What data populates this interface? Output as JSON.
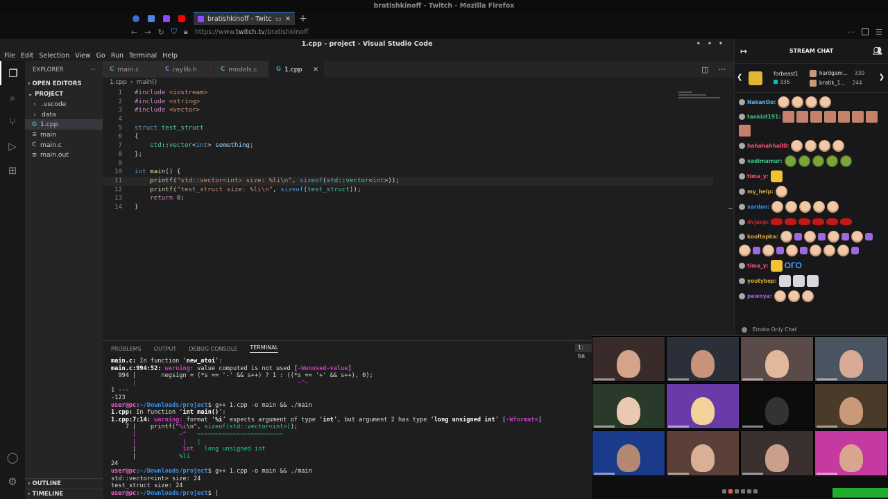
{
  "browser": {
    "window_title": "bratishkinoff - Twitch - Mozilla Firefox",
    "tab_title": "bratishkinoff - Twitch",
    "url_prefix": "https://www.",
    "url_host": "twitch.tv",
    "url_path": "/bratishkinoff",
    "new_tab_glyph": "+",
    "tab_close_glyph": "✕"
  },
  "vscode": {
    "window_title": "1.cpp - project - Visual Studio Code",
    "menu": [
      "File",
      "Edit",
      "Selection",
      "View",
      "Go",
      "Run",
      "Terminal",
      "Help"
    ],
    "explorer": {
      "header": "EXPLORER",
      "open_editors": "OPEN EDITORS",
      "project": "PROJECT",
      "items": [
        {
          "label": ".vscode",
          "kind": "folder"
        },
        {
          "label": "data",
          "kind": "folder"
        },
        {
          "label": "1.cpp",
          "kind": "cpp",
          "selected": true
        },
        {
          "label": "main",
          "kind": "file"
        },
        {
          "label": "main.c",
          "kind": "c"
        },
        {
          "label": "main.out",
          "kind": "file"
        }
      ],
      "outline": "OUTLINE",
      "timeline": "TIMELINE"
    },
    "tabs": [
      {
        "label": "main.c",
        "icon": "C",
        "active": false
      },
      {
        "label": "raylib.h",
        "icon": "C",
        "active": false
      },
      {
        "label": "models.c",
        "icon": "C",
        "active": false
      },
      {
        "label": "1.cpp",
        "icon": "G",
        "active": true
      }
    ],
    "breadcrumb": [
      "1.cpp",
      "main()"
    ],
    "code_lines": [
      "1",
      "2",
      "3",
      "4",
      "5",
      "6",
      "7",
      "8",
      "9",
      "10",
      "11",
      "12",
      "13",
      "14"
    ],
    "panel_tabs": [
      "PROBLEMS",
      "OUTPUT",
      "DEBUG CONSOLE",
      "TERMINAL"
    ],
    "side_label": "1: ba"
  },
  "terminal": {
    "l1_file": "main.c:",
    "l1_text": " In function ‘",
    "l1_fn": "new_atoi",
    "l1_end": "’:",
    "l2_loc": "main.c:994:52:",
    "l2_warn": "warning:",
    "l2_msg": " value computed is not used [",
    "l2_flag": "-Wunused-value",
    "l2_end": "]",
    "l3": "  994 |       negsign = (*s == '-' && s++) ? 1 : ((*s == '+' && s++), 0);",
    "l4": "      |                                             ~^~",
    "l5": "1 ---",
    "l6": "-123",
    "p_user": "user@pc",
    "p_path": "~/Downloads/project",
    "cmd": "$ g++ 1.cpp -o main && ./main",
    "l8_file": "1.cpp:",
    "l8_text": " In function ‘",
    "l8_fn": "int main()",
    "l8_end": "’:",
    "l9_loc": "1.cpp:7:14:",
    "l9_warn": "warning:",
    "l9_msg": " format ‘",
    "l9_f": "%i",
    "l9_msg2": "’ expects argument of type ‘",
    "l9_t1": "int",
    "l9_msg3": "’, but argument 2 has type ‘",
    "l9_t2": "long unsigned int",
    "l9_msg4": "’ [",
    "l9_flag": "-Wformat=",
    "l9_end": "]",
    "l10a": "    7 |    printf(\"",
    "l10b": "%i",
    "l10c": "\\n\", ",
    "l10d": "sizeof(std::vector<int>)",
    "l10e": ");",
    "l11a": "      |            ~^   ",
    "l11b": "~~~~~~~~~~~~~~~~~~~~~~~~",
    "l12a": "      |             |   ",
    "l12b": "|",
    "l13a": "      |             ",
    "l13b": "int",
    "l13c": "   ",
    "l13d": "long unsigned int",
    "l14a": "      |            ",
    "l14b": "%li",
    "l15": "24",
    "l17": "std::vector<int> size: 24",
    "l18": "test_struct size: 24",
    "cursor": "$ |"
  },
  "chat": {
    "title": "STREAM CHAT",
    "gift_top": {
      "name": "forbeast1",
      "count": "336"
    },
    "gift_list": [
      {
        "name": "hardgam...",
        "count": "330"
      },
      {
        "name": "bratik_1...",
        "count": "244"
      }
    ],
    "messages": [
      {
        "user": "NakanOo:",
        "color": "#5ab4e6",
        "emotes": [
          "face",
          "face",
          "face",
          "face"
        ]
      },
      {
        "user": "tankist191:",
        "color": "#3cc180",
        "emotes": [
          "sq",
          "sq",
          "sq",
          "sq",
          "sq",
          "sq",
          "sq",
          "sq"
        ]
      },
      {
        "user": "hahahahha00:",
        "color": "#ff4f6b",
        "emotes": [
          "face",
          "face",
          "face",
          "face"
        ]
      },
      {
        "user": "vadimamur:",
        "color": "#3cc180",
        "emotes": [
          "frog",
          "frog",
          "frog",
          "frog",
          "frog"
        ]
      },
      {
        "user": "tima_y:",
        "color": "#ff4f6b",
        "emotes": [
          "gold"
        ]
      },
      {
        "user": "my_help:",
        "color": "#d4a63a",
        "emotes": [
          "face"
        ]
      },
      {
        "user": "xardon:",
        "color": "#3b8eea",
        "emotes": [
          "face",
          "face",
          "face",
          "face",
          "face"
        ]
      },
      {
        "user": "dvjaxp:",
        "color": "#d91c1c",
        "emotes": [
          "lips",
          "lips",
          "lips",
          "lips",
          "lips",
          "lips"
        ]
      },
      {
        "user": "kooltapka:",
        "color": "#d4a63a",
        "emotes": [
          "face",
          "heart",
          "face",
          "heart",
          "face",
          "heart",
          "face",
          "heart",
          "face",
          "heart",
          "face",
          "heart",
          "face",
          "heart",
          "face",
          "face",
          "face",
          "heart"
        ]
      },
      {
        "user": "tima_y:",
        "color": "#ff4f6b",
        "emotes": [
          "gold"
        ],
        "text": "ОГО"
      },
      {
        "user": "youtybep:",
        "color": "#d4a63a",
        "emotes": [
          "hand",
          "hand",
          "hand"
        ]
      },
      {
        "user": "pewnya:",
        "color": "#9b6adf",
        "emotes": [
          "face",
          "face",
          "face"
        ]
      }
    ],
    "emote_only": "Emote Only Chat"
  }
}
